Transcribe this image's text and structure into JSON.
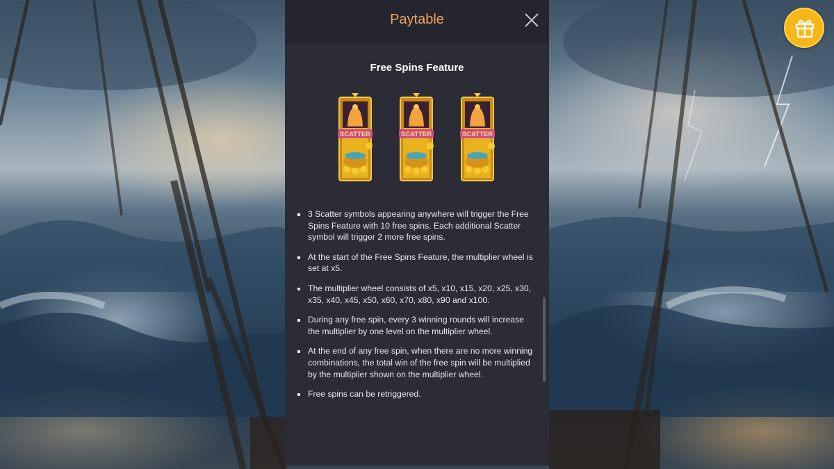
{
  "paytable": {
    "title": "Paytable",
    "section_title": "Free Spins Feature",
    "symbols": [
      {
        "name": "scatter-symbol",
        "label": "SCATTER"
      },
      {
        "name": "scatter-symbol",
        "label": "SCATTER"
      },
      {
        "name": "scatter-symbol",
        "label": "SCATTER"
      }
    ],
    "rules": [
      "3 Scatter symbols appearing anywhere will trigger the Free Spins Feature with 10 free spins. Each additional Scatter symbol will trigger 2 more free spins.",
      "At the start of the Free Spins Feature, the multiplier wheel is set at x5.",
      "The multiplier wheel consists of x5, x10, x15, x20, x25, x30, x35, x40, x45, x50, x60, x70, x80, x90 and x100.",
      "During any free spin, every 3 winning rounds will increase the multiplier by one level on the multiplier wheel.",
      "At the end of any free spin, when there are no more winning combinations, the total win of the free spin will be multiplied by the multiplier shown on the multiplier wheel.",
      "Free spins can be retriggered."
    ]
  },
  "icons": {
    "close": "close-icon",
    "gift": "gift-icon"
  },
  "colors": {
    "title": "#f2a25a",
    "panel": "#2b2c36",
    "gift": "#f7b718"
  }
}
